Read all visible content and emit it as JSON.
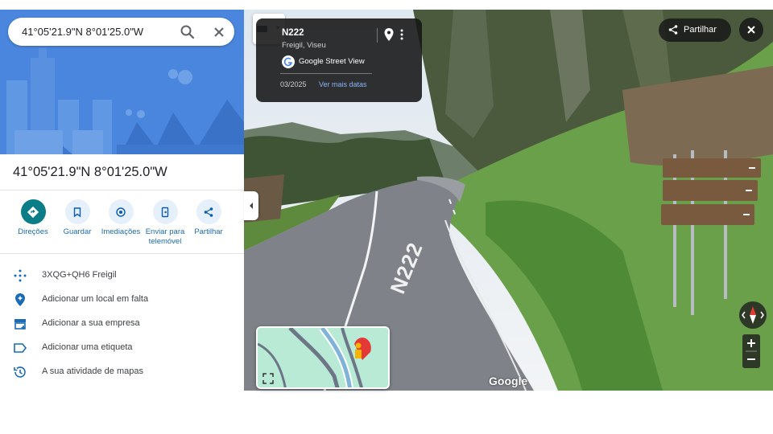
{
  "search": {
    "query": "41°05'21.9\"N 8°01'25.0\"W"
  },
  "place": {
    "title": "41°05'21.9\"N 8°01'25.0\"W"
  },
  "actions": [
    {
      "label": "Direções",
      "icon": "directions-icon"
    },
    {
      "label": "Guardar",
      "icon": "bookmark-icon"
    },
    {
      "label": "Imediações",
      "icon": "nearby-icon"
    },
    {
      "label": "Enviar para telemóvel",
      "icon": "send-to-phone-icon"
    },
    {
      "label": "Partilhar",
      "icon": "share-icon"
    }
  ],
  "info": [
    {
      "text": "3XQG+QH6 Freigil",
      "icon": "plus-code-icon"
    },
    {
      "text": "Adicionar um local em falta",
      "icon": "add-place-icon"
    },
    {
      "text": "Adicionar a sua empresa",
      "icon": "store-icon"
    },
    {
      "text": "Adicionar uma etiqueta",
      "icon": "label-icon"
    },
    {
      "text": "A sua atividade de mapas",
      "icon": "history-icon"
    }
  ],
  "street_view": {
    "road": "N222",
    "location": "Freigil, Viseu",
    "provider": "Google Street View",
    "date": "03/2025",
    "more_dates": "Ver mais datas",
    "share_label": "Partilhar",
    "watermark": "Google",
    "road_marking": "N222"
  },
  "colors": {
    "accent": "#0b7d86",
    "link": "#1a6bb5",
    "hero": "#4a86de"
  }
}
